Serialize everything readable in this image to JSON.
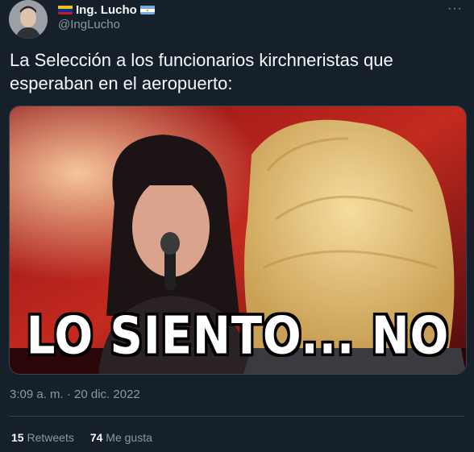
{
  "author": {
    "name": "Ing. Lucho",
    "handle": "@IngLucho",
    "flag_left": "venezuela-flag-icon",
    "flag_right": "argentina-flag-icon"
  },
  "tweet": {
    "text": "La Selección a los funcionarios kirchneristas que esperaban en el aeropuerto:",
    "media_caption": "LO SIENTO... NO",
    "time": "3:09 a. m. · 20 dic. 2022"
  },
  "stats": {
    "retweets_count": "15",
    "retweets_label": "Retweets",
    "likes_count": "74",
    "likes_label": "Me gusta"
  },
  "more_label": "···",
  "colors": {
    "background": "#15202b",
    "text": "#f7f9f9",
    "secondary": "#8b98a5",
    "border": "#38444d"
  }
}
